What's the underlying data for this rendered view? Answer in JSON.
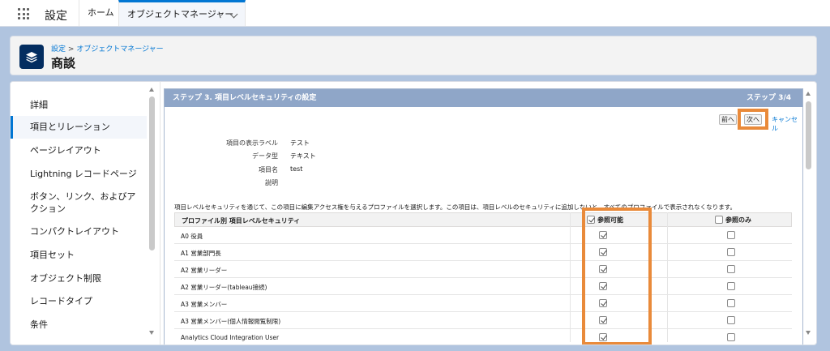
{
  "topnav": {
    "app_name": "設定",
    "tabs": [
      {
        "label": "ホーム"
      },
      {
        "label": "オブジェクトマネージャー"
      }
    ]
  },
  "header": {
    "breadcrumb_parent": "設定",
    "breadcrumb_separator": ">",
    "breadcrumb_current": "オブジェクトマネージャー",
    "title": "商談",
    "icon": "layers-icon"
  },
  "sidebar": {
    "items": [
      {
        "label": "詳細",
        "active": false
      },
      {
        "label": "項目とリレーション",
        "active": true
      },
      {
        "label": "ページレイアウト",
        "active": false
      },
      {
        "label": "Lightning レコードページ",
        "active": false
      },
      {
        "label": "ボタン、リンク、およびア",
        "label2": "クション",
        "active": false
      },
      {
        "label": "コンパクトレイアウト",
        "active": false
      },
      {
        "label": "項目セット",
        "active": false
      },
      {
        "label": "オブジェクト制限",
        "active": false
      },
      {
        "label": "レコードタイプ",
        "active": false
      },
      {
        "label": "条件",
        "active": false
      }
    ]
  },
  "wizard": {
    "step_title": "ステップ 3. 項目レベルセキュリティの設定",
    "step_count": "ステップ 3/4",
    "buttons": {
      "prev": "前へ",
      "next": "次へ",
      "cancel": "キャンセル"
    },
    "details": [
      {
        "label": "項目の表示ラベル",
        "value": "テスト"
      },
      {
        "label": "データ型",
        "value": "テキスト"
      },
      {
        "label": "項目名",
        "value": "test"
      },
      {
        "label": "説明",
        "value": ""
      }
    ],
    "info_text": "項目レベルセキュリティを通じて、この項目に編集アクセス権を与えるプロファイルを選択します。この項目は、項目レベルのセキュリティに追加しないと、すべてのプロファイルで表示されなくなります。",
    "table": {
      "header_profile": "プロファイル別 項目レベルセキュリティ",
      "header_visible": "参照可能",
      "header_readonly": "参照のみ",
      "header_visible_checked": true,
      "header_readonly_checked": false,
      "rows": [
        {
          "name": "A0 役員",
          "visible": true,
          "readonly": false
        },
        {
          "name": "A1 営業部門長",
          "visible": true,
          "readonly": false
        },
        {
          "name": "A2 営業リーダー",
          "visible": true,
          "readonly": false
        },
        {
          "name": "A2 営業リーダー(tableau接続)",
          "visible": true,
          "readonly": false
        },
        {
          "name": "A3 営業メンバー",
          "visible": true,
          "readonly": false
        },
        {
          "name": "A3 営業メンバー(個人情報閲覧制限)",
          "visible": true,
          "readonly": false
        },
        {
          "name": "Analytics Cloud Integration User",
          "visible": true,
          "readonly": false
        }
      ]
    }
  },
  "colors": {
    "band": "#b0c4df",
    "step_bar": "#8fa6c8",
    "highlight": "#e98a3a",
    "accent": "#0176d3"
  }
}
